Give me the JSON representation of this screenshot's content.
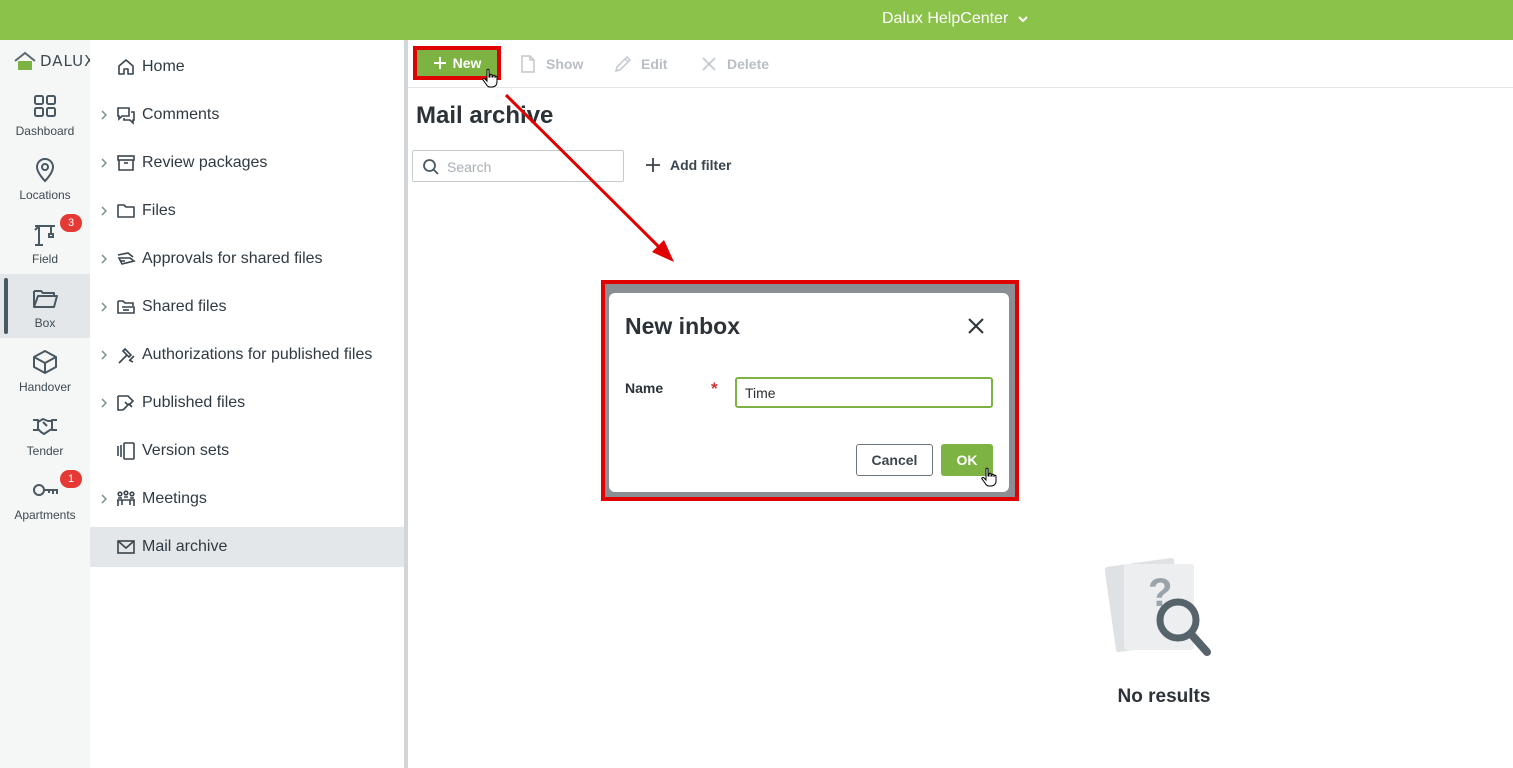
{
  "topbar": {
    "helpcenter_label": "Dalux HelpCenter",
    "icon": "chevron-down-icon",
    "color": "#8bc34a"
  },
  "rail": {
    "logo_text": "DALUX",
    "items": [
      {
        "label": "Dashboard",
        "icon": "dashboard-grid-icon"
      },
      {
        "label": "Locations",
        "icon": "location-pin-icon"
      },
      {
        "label": "Field",
        "icon": "crane-icon",
        "badge": "3"
      },
      {
        "label": "Box",
        "icon": "folder-open-icon",
        "active": true
      },
      {
        "label": "Handover",
        "icon": "box-icon"
      },
      {
        "label": "Tender",
        "icon": "handshake-icon"
      },
      {
        "label": "Apartments",
        "icon": "key-icon",
        "badge": "1"
      }
    ]
  },
  "nav": {
    "items": [
      {
        "label": "Home",
        "icon": "home-icon"
      },
      {
        "label": "Comments",
        "icon": "comments-icon",
        "expandable": true
      },
      {
        "label": "Review packages",
        "icon": "archive-box-icon",
        "expandable": true
      },
      {
        "label": "Files",
        "icon": "folder-icon",
        "expandable": true
      },
      {
        "label": "Approvals for shared files",
        "icon": "approval-icon",
        "expandable": true
      },
      {
        "label": "Shared files",
        "icon": "shared-files-icon",
        "expandable": true
      },
      {
        "label": "Authorizations for published files",
        "icon": "authorization-icon",
        "expandable": true
      },
      {
        "label": "Published files",
        "icon": "published-files-icon",
        "expandable": true
      },
      {
        "label": "Version sets",
        "icon": "version-sets-icon"
      },
      {
        "label": "Meetings",
        "icon": "meetings-icon",
        "expandable": true
      },
      {
        "label": "Mail archive",
        "icon": "mail-icon",
        "active": true
      }
    ]
  },
  "toolbar": {
    "new_label": "New",
    "show_label": "Show",
    "edit_label": "Edit",
    "delete_label": "Delete"
  },
  "main": {
    "title": "Mail archive",
    "search_placeholder": "Search",
    "add_filter_label": "Add filter",
    "no_results_label": "No results"
  },
  "dialog": {
    "title": "New inbox",
    "name_label": "Name",
    "required_marker": "*",
    "name_value": "Time",
    "cancel_label": "Cancel",
    "ok_label": "OK"
  },
  "colors": {
    "accent": "#7cb342",
    "highlight": "#e00000",
    "badge": "#e53935"
  }
}
